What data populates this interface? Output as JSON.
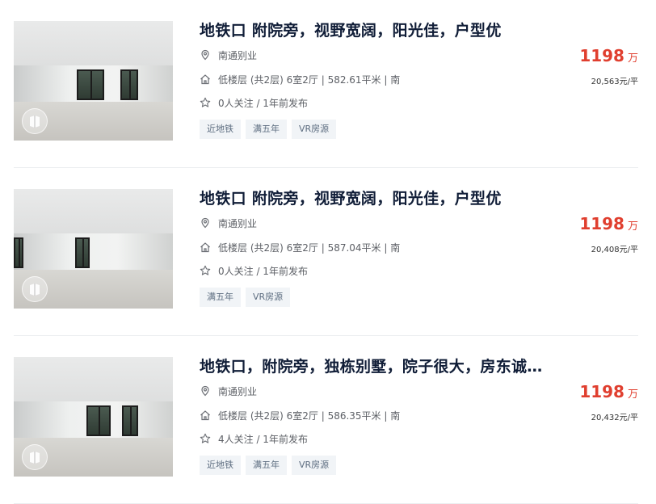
{
  "listings": [
    {
      "title": "地铁口 附院旁，视野宽阔，阳光佳，户型优",
      "region": "南通别业",
      "house_info": "低楼层 (共2层) 6室2厅 | 582.61平米 | 南",
      "follow_info": "0人关注 / 1年前发布",
      "tags": [
        "近地铁",
        "满五年",
        "VR房源"
      ],
      "total_price": "1198",
      "price_unit": "万",
      "unit_price": "20,563元/平"
    },
    {
      "title": "地铁口 附院旁，视野宽阔，阳光佳，户型优",
      "region": "南通别业",
      "house_info": "低楼层 (共2层) 6室2厅 | 587.04平米 | 南",
      "follow_info": "0人关注 / 1年前发布",
      "tags": [
        "满五年",
        "VR房源"
      ],
      "total_price": "1198",
      "price_unit": "万",
      "unit_price": "20,408元/平"
    },
    {
      "title": "地铁口，附院旁，独栋别墅，院子很大，房东诚…",
      "region": "南通别业",
      "house_info": "低楼层 (共2层) 6室2厅 | 586.35平米 | 南",
      "follow_info": "4人关注 / 1年前发布",
      "tags": [
        "近地铁",
        "满五年",
        "VR房源"
      ],
      "total_price": "1198",
      "price_unit": "万",
      "unit_price": "20,432元/平"
    }
  ],
  "icons": {
    "region": "location-pin-icon",
    "house": "house-icon",
    "follow": "star-icon",
    "vr": "vr-badge-icon"
  },
  "colors": {
    "title": "#101d37",
    "price": "#e03f2f",
    "tag_bg": "#f1f4f7",
    "tag_text": "#5d6d80"
  }
}
